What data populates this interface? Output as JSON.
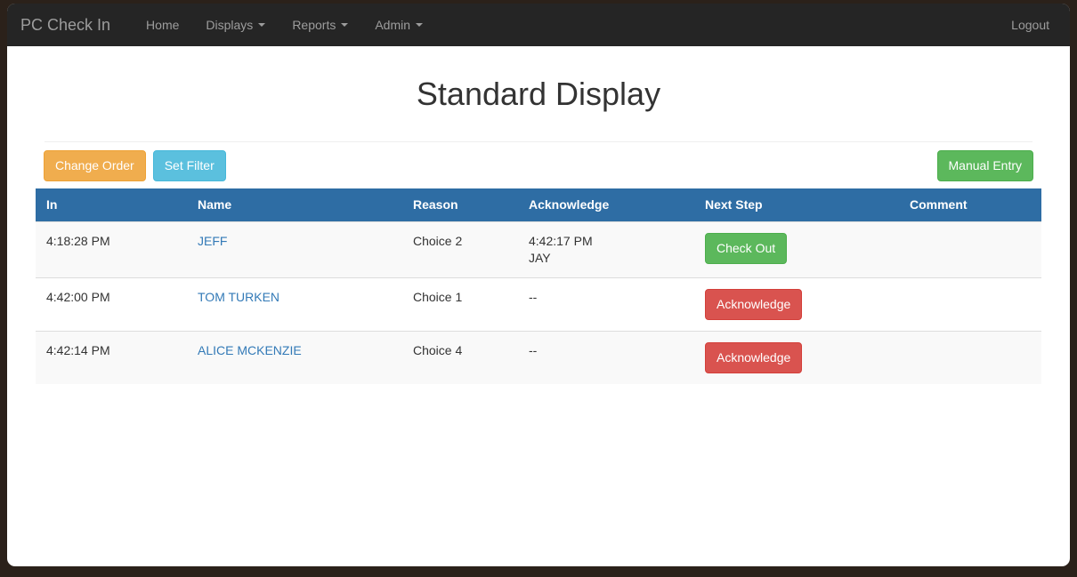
{
  "navbar": {
    "brand": "PC Check In",
    "items": [
      {
        "label": "Home",
        "caret": false
      },
      {
        "label": "Displays",
        "caret": true
      },
      {
        "label": "Reports",
        "caret": true
      },
      {
        "label": "Admin",
        "caret": true
      }
    ],
    "logout_label": "Logout"
  },
  "page": {
    "title": "Standard Display"
  },
  "toolbar": {
    "change_order_label": "Change Order",
    "set_filter_label": "Set Filter",
    "manual_entry_label": "Manual Entry"
  },
  "table": {
    "columns": [
      "In",
      "Name",
      "Reason",
      "Acknowledge",
      "Next Step",
      "Comment"
    ],
    "rows": [
      {
        "in": "4:18:28 PM",
        "name": "JEFF",
        "reason": "Choice 2",
        "acknowledge_time": "4:42:17 PM",
        "acknowledge_by": "JAY",
        "next_step_label": "Check Out",
        "next_step_style": "success",
        "comment": ""
      },
      {
        "in": "4:42:00 PM",
        "name": "TOM TURKEN",
        "reason": "Choice 1",
        "acknowledge_time": "--",
        "acknowledge_by": "",
        "next_step_label": "Acknowledge",
        "next_step_style": "danger",
        "comment": ""
      },
      {
        "in": "4:42:14 PM",
        "name": "ALICE MCKENZIE",
        "reason": "Choice 4",
        "acknowledge_time": "--",
        "acknowledge_by": "",
        "next_step_label": "Acknowledge",
        "next_step_style": "danger",
        "comment": ""
      }
    ]
  },
  "colors": {
    "navbar_bg": "#252525",
    "navbar_text": "#9d9d9d",
    "table_header_bg": "#2e6da4",
    "link": "#337ab7",
    "warning": "#f0ad4e",
    "info": "#5bc0de",
    "success": "#5cb85c",
    "danger": "#d9534f",
    "frame": "#2b211a"
  }
}
